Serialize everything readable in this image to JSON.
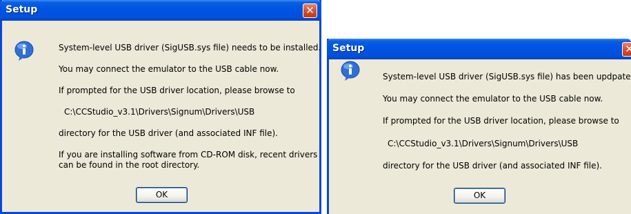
{
  "dialog1": {
    "title": "Setup",
    "close_glyph": "✕",
    "icon": "info-icon",
    "lines": [
      "System-level USB driver (SigUSB.sys file) needs to be installed.",
      "You may connect the emulator to the USB cable now.",
      "If prompted for the USB driver location, please browse to",
      "C:\\CCStudio_v3.1\\Drivers\\Signum\\Drivers\\USB",
      "directory for the USB driver (and associated INF file).",
      "If you are installing software from CD-ROM disk, recent drivers",
      "can be found in the root directory."
    ],
    "ok_label": "OK"
  },
  "dialog2": {
    "title": "Setup",
    "close_glyph": "✕",
    "icon": "info-icon",
    "lines": [
      "System-level USB driver (SigUSB.sys file) has been updpated.",
      "You may connect the emulator to the USB cable now.",
      "If prompted for the USB driver location, please browse to",
      "C:\\CCStudio_v3.1\\Drivers\\Signum\\Drivers\\USB",
      "directory for the USB driver (and associated INF file)."
    ],
    "ok_label": "OK"
  },
  "colors": {
    "titlebar": "#0054e3",
    "dialog_bg": "#ece9d8",
    "close_button": "#d8553a"
  }
}
